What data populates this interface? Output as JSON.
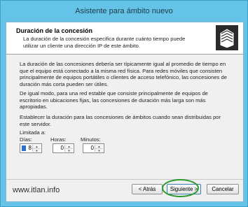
{
  "window": {
    "title": "Asistente para ámbito nuevo"
  },
  "header": {
    "title": "Duración de la concesión",
    "subtitle": "La duración de la concesión especifica durante cuánto tiempo puede utilizar un cliente una dirección IP de este ámbito."
  },
  "body": {
    "paragraph1": "La duración de las concesiones debería ser típicamente igual al promedio de tiempo en que el equipo está conectado a la misma red física. Para redes móviles que consisten principalmente de equipos portátiles o clientes de acceso telefónico, las concesiones de duración más corta pueden ser útiles.",
    "paragraph2": "De igual modo, para una red estable que consiste principalmente de equipos de escritorio en ubicaciones fijas, las concesiones de duración más larga son más apropiadas.",
    "paragraph3": "Establecer la duración para las concesiones de ámbitos cuando sean distribuidas por este servidor."
  },
  "limit": {
    "label": "Limitada a:",
    "days": {
      "label": "Días:",
      "value": "8"
    },
    "hours": {
      "label": "Horas:",
      "value": "0"
    },
    "minutes": {
      "label": "Minutos:",
      "value": "0"
    }
  },
  "buttons": {
    "back": "< Atrás",
    "next": "Siguiente >",
    "cancel": "Cancelar"
  },
  "watermark": "www.itlan.info",
  "colors": {
    "frame": "#64c3e6",
    "highlight": "#2c9a2c"
  },
  "icons": [
    "wizard-folder-icon",
    "spin-up-icon",
    "spin-down-icon"
  ]
}
